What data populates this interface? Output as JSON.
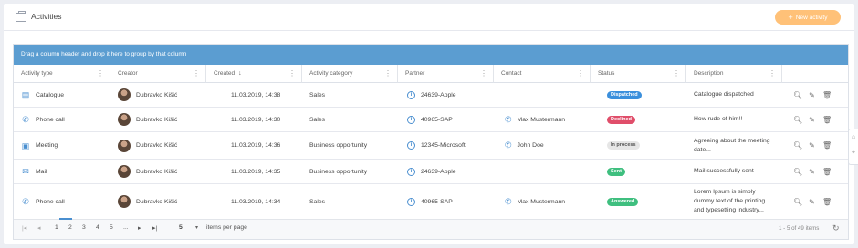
{
  "header": {
    "title": "Activities",
    "new_button": "New activity"
  },
  "grid": {
    "group_hint": "Drag a column header and drop it here to group by that column",
    "columns": [
      "Activity type",
      "Creator",
      "Created",
      "Activity category",
      "Partner",
      "Contact",
      "Status",
      "Description"
    ],
    "rows": [
      {
        "type": "Catalogue",
        "type_icon": "catalogue-icon",
        "creator": "Dubravko Kišić",
        "created": "11.03.2019, 14:38",
        "category": "Sales",
        "partner": "24639-Apple",
        "contact": "",
        "status": "Dispatched",
        "status_color": "#3b8fdc",
        "description_1": "Catalogue dispatched",
        "description_2": ""
      },
      {
        "type": "Phone call",
        "type_icon": "phone-icon",
        "creator": "Dubravko Kišić",
        "created": "11.03.2019, 14:30",
        "category": "Sales",
        "partner": "40965-SAP",
        "contact": "Max Mustermann",
        "status": "Declined",
        "status_color": "#e04e6a",
        "description_1": "How rude of him!!",
        "description_2": ""
      },
      {
        "type": "Meeting",
        "type_icon": "meeting-icon",
        "creator": "Dubravko Kišić",
        "created": "11.03.2019, 14:36",
        "category": "Business opportunity",
        "partner": "12345-Microsoft",
        "contact": "John Doe",
        "status": "In process",
        "status_color": "#e4e4e4",
        "description_1": "Agreeing about the meeting",
        "description_2": "date..."
      },
      {
        "type": "Mail",
        "type_icon": "mail-icon",
        "creator": "Dubravko Kišić",
        "created": "11.03.2019, 14:35",
        "category": "Business opportunity",
        "partner": "24639-Apple",
        "contact": "",
        "status": "Sent",
        "status_color": "#3fbf7f",
        "description_1": "Mail successfully sent",
        "description_2": ""
      },
      {
        "type": "Phone call",
        "type_icon": "phone-icon",
        "creator": "Dubravko Kišić",
        "created": "11.03.2019, 14:34",
        "category": "Sales",
        "partner": "40965-SAP",
        "contact": "Max Mustermann",
        "status": "Answered",
        "status_color": "#3fbf7f",
        "description_1": "Lorem Ipsum is simply",
        "description_2": "dummy text of the printing",
        "description_3": "and typesetting industry..."
      }
    ]
  },
  "pager": {
    "pages": [
      "1",
      "2",
      "3",
      "4",
      "5",
      "..."
    ],
    "page_size": "5",
    "per_page_label": "items per page",
    "item_count": "1 - 5 of 49 items"
  }
}
